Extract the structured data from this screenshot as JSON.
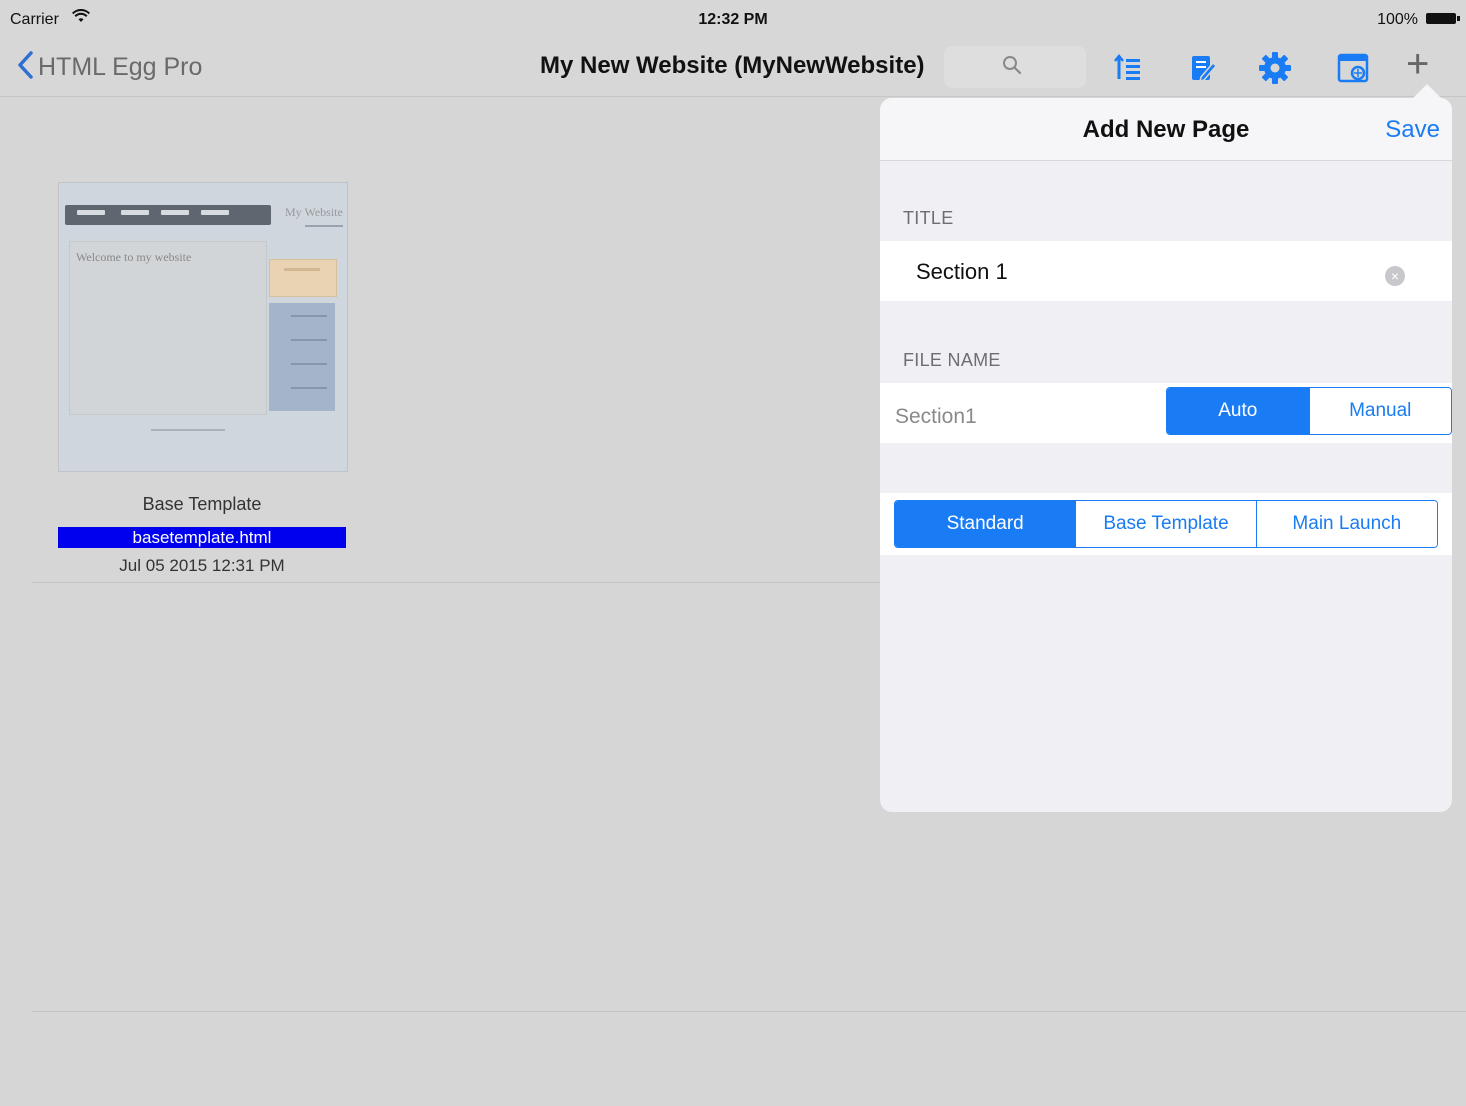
{
  "status": {
    "carrier": "Carrier",
    "time": "12:32 PM",
    "battery": "100%"
  },
  "nav": {
    "back_label": "HTML Egg Pro",
    "title": "My New Website (MyNewWebsite)",
    "tools": [
      "outline-icon",
      "edit-page-icon",
      "gear-icon",
      "preview-icon"
    ],
    "plus": "+"
  },
  "file": {
    "thumbnail": {
      "site_title": "My Website",
      "welcome": "Welcome to my website"
    },
    "name": "Base Template",
    "link": "basetemplate.html",
    "date": "Jul 05 2015 12:31 PM"
  },
  "popover": {
    "title": "Add New Page",
    "save_label": "Save",
    "title_section": "TITLE",
    "title_value": "Section 1",
    "filename_section": "FILE NAME",
    "filename_value": "Section1",
    "filename_modes": [
      "Auto",
      "Manual"
    ],
    "filename_mode_selected": "Auto",
    "template_options": [
      "Standard",
      "Base Template",
      "Main Launch"
    ],
    "template_selected": "Standard"
  },
  "colors": {
    "accent": "#1a7cf4",
    "link_bg": "#0000ee",
    "panel_bg": "#efeff4",
    "page_bg": "#d6d6d6"
  }
}
